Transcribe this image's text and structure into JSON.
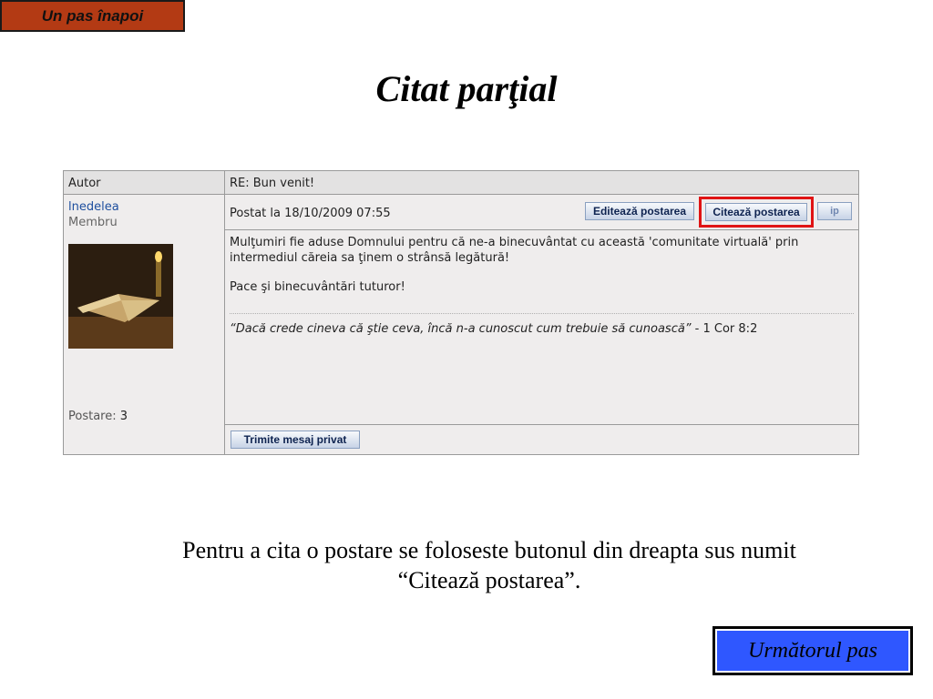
{
  "nav": {
    "back": "Un pas înapoi",
    "next": "Următorul pas"
  },
  "title": "Citat parţial",
  "post": {
    "header_author": "Autor",
    "header_subject": "RE: Bun venit!",
    "author_name": "lnedelea",
    "author_role": "Membru",
    "post_count_label": "Postare:",
    "post_count_value": "3",
    "posted": "Postat la 18/10/2009 07:55",
    "edit_button": "Editează postarea",
    "quote_button": "Citează postarea",
    "ip_button": "ip",
    "body_1": "Mulţumiri fie aduse Domnului pentru că ne-a binecuvântat cu această 'comunitate virtuală' prin intermediul căreia sa ţinem o strânsă legătură!",
    "body_2": "Pace şi binecuvântări tuturor!",
    "signature_quote": "“Dacă crede cineva că ştie ceva, încă n-a cunoscut cum trebuie să cunoască”",
    "signature_ref": " - 1 Cor 8:2",
    "pm_button": "Trimite mesaj privat"
  },
  "caption_line1": "Pentru a cita o postare se foloseste butonul din dreapta sus numit",
  "caption_line2": "“Citează postarea”."
}
